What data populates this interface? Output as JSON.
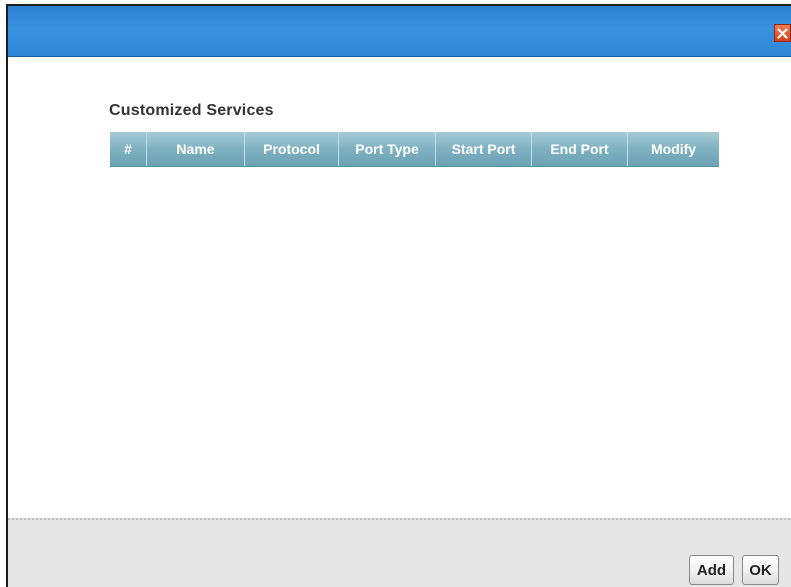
{
  "dialog": {
    "close_icon": "close-x-icon"
  },
  "section": {
    "title": "Customized Services"
  },
  "table": {
    "columns": [
      "#",
      "Name",
      "Protocol",
      "Port Type",
      "Start Port",
      "End Port",
      "Modify"
    ],
    "rows": []
  },
  "footer": {
    "add_label": "Add",
    "ok_label": "OK"
  },
  "colors": {
    "titlebar": "#3a93df",
    "table_header": "#7fb1c1",
    "close_button": "#d6421a",
    "footer_bg": "#e6e6e6"
  }
}
